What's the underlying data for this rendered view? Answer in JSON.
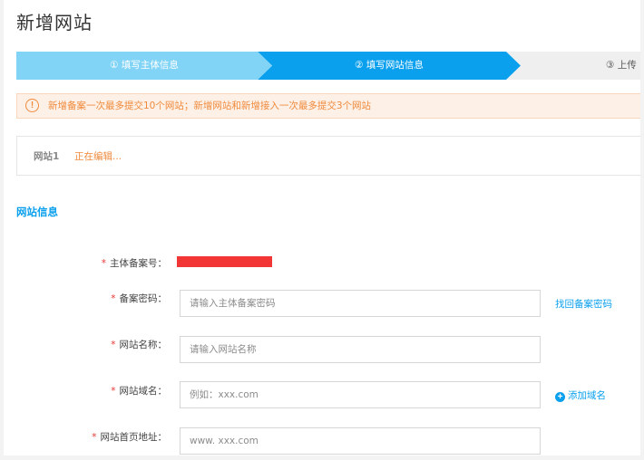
{
  "page": {
    "title": "新增网站"
  },
  "steps": [
    {
      "label": "① 填写主体信息",
      "state": "done"
    },
    {
      "label": "② 填写网站信息",
      "state": "active"
    },
    {
      "label": "③ 上传",
      "state": "pending"
    }
  ],
  "notice": {
    "icon": "warning-circle-icon",
    "text": "新增备案一次最多提交10个网站；新增网站和新增接入一次最多提交3个网站"
  },
  "site_card": {
    "label": "网站1",
    "status": "正在编辑..."
  },
  "section": {
    "title": "网站信息"
  },
  "form": {
    "required_mark": "*",
    "entity_record_no": {
      "label": "主体备案号："
    },
    "record_password": {
      "label": "备案密码：",
      "placeholder": "请输入主体备案密码",
      "link": "找回备案密码"
    },
    "site_name": {
      "label": "网站名称：",
      "placeholder": "请输入网站名称"
    },
    "site_domain": {
      "label": "网站域名：",
      "placeholder": "例如：xxx.com",
      "link": "添加域名",
      "link_icon": "plus-circle-icon"
    },
    "homepage_url": {
      "label": "网站首页地址：",
      "placeholder": "www. xxx.com"
    }
  },
  "colors": {
    "accent": "#0ba0ed",
    "step_done": "#82d4f7",
    "warning": "#f08a3c",
    "required": "#e53935",
    "redacted": "#f23535"
  }
}
